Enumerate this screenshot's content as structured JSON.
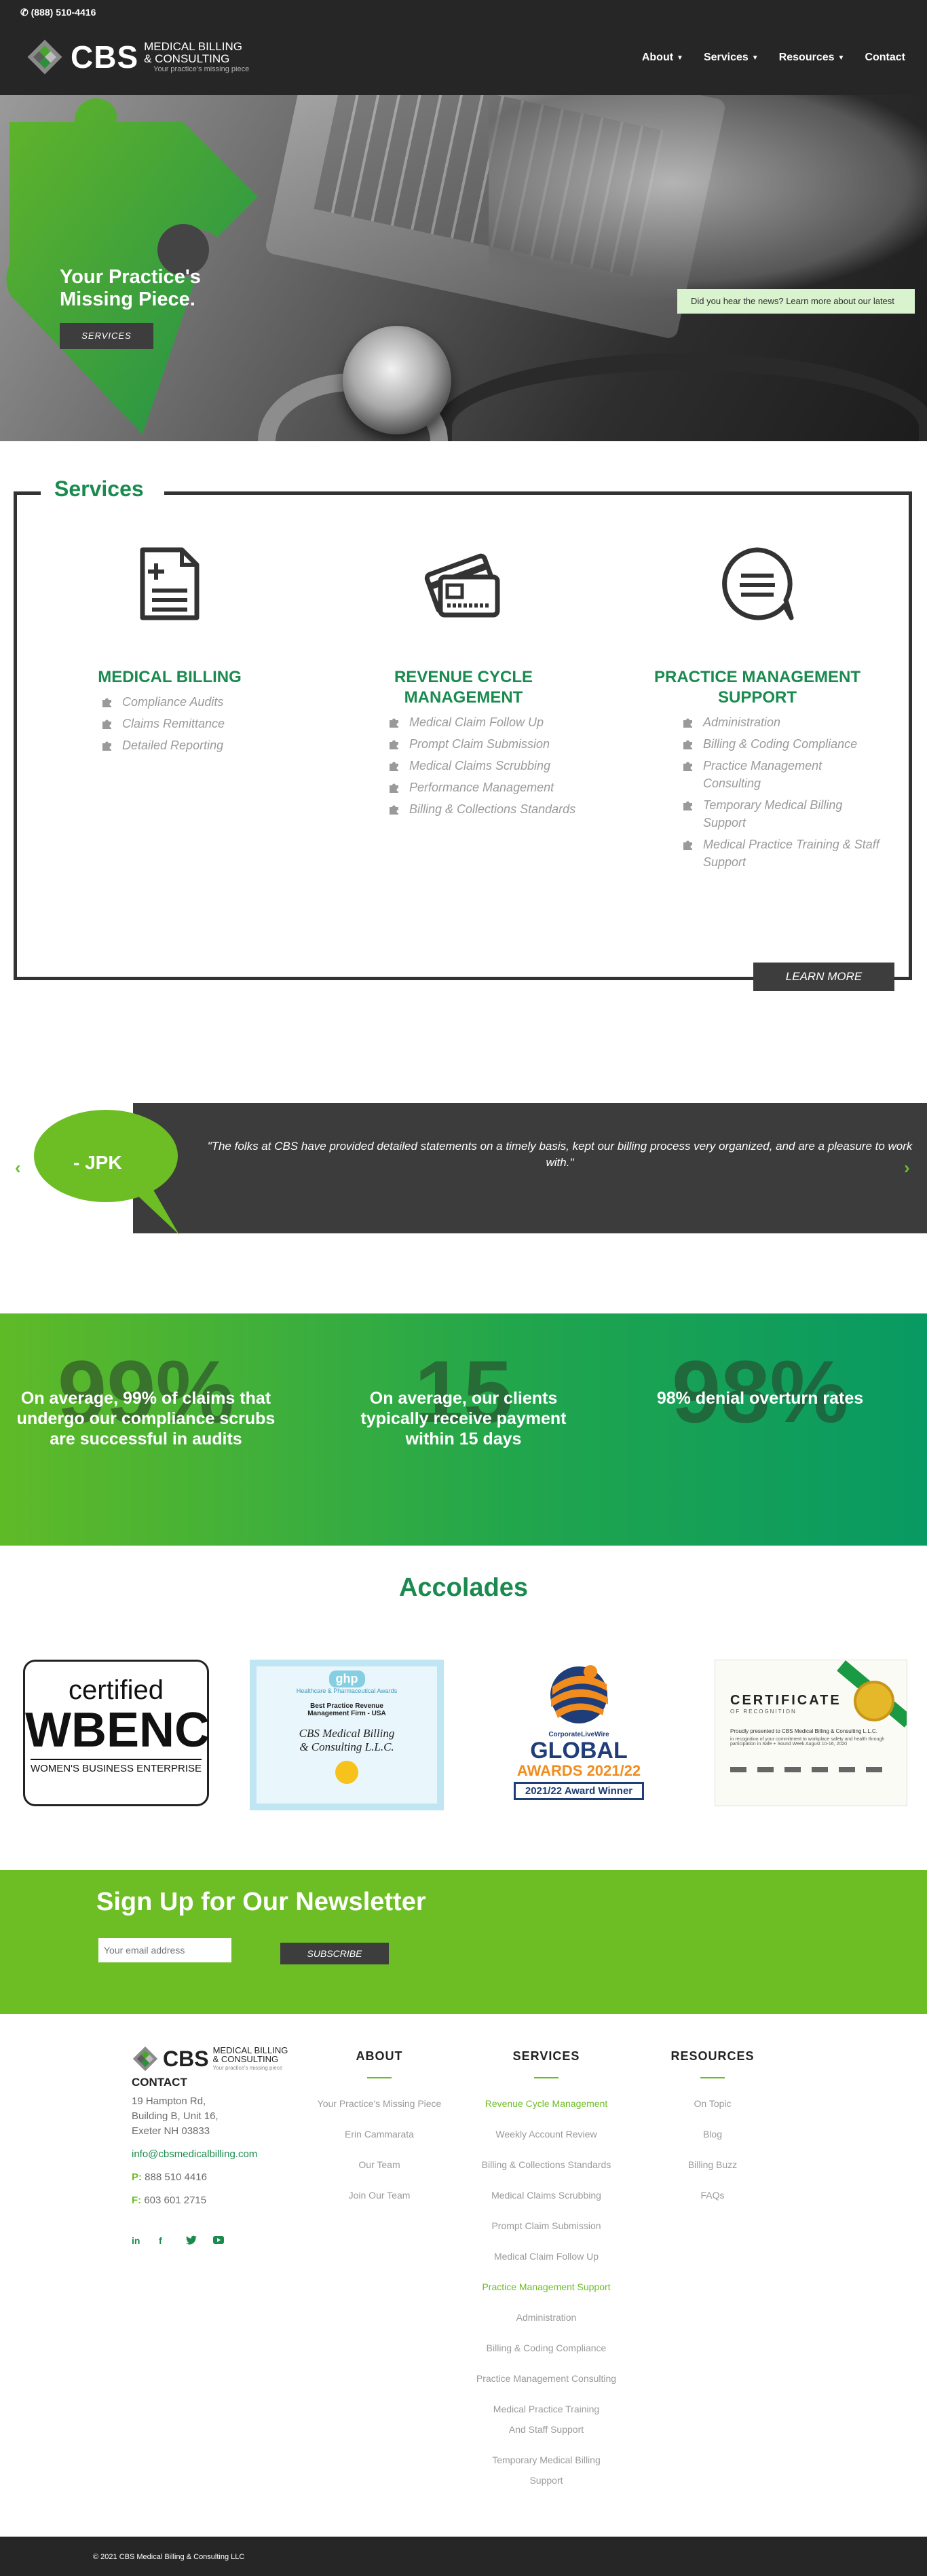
{
  "topbar": {
    "phone": "(888) 510-4416"
  },
  "header": {
    "logo_cbs": "CBS",
    "logo_line1": "MEDICAL BILLING",
    "logo_line2": "& CONSULTING",
    "logo_tagline": "Your practice's missing piece",
    "nav": [
      {
        "label": "About",
        "has_dropdown": true
      },
      {
        "label": "Services",
        "has_dropdown": true
      },
      {
        "label": "Resources",
        "has_dropdown": true
      },
      {
        "label": "Contact",
        "has_dropdown": false
      }
    ]
  },
  "hero": {
    "title_line1": "Your Practice's",
    "title_line2": "Missing Piece.",
    "button": "SERVICES",
    "note": "Did you hear the news? Learn more about our latest"
  },
  "services": {
    "heading": "Services",
    "columns": [
      {
        "icon": "document-icon",
        "title": "MEDICAL BILLING",
        "items": [
          "Compliance Audits",
          "Claims Remittance",
          "Detailed Reporting"
        ]
      },
      {
        "icon": "credit-card-icon",
        "title": "REVENUE CYCLE MANAGEMENT",
        "items": [
          "Medical Claim Follow Up",
          "Prompt Claim Submission",
          "Medical Claims Scrubbing",
          "Performance Management",
          "Billing & Collections Standards"
        ]
      },
      {
        "icon": "chat-bubble-icon",
        "title": "PRACTICE MANAGEMENT SUPPORT",
        "items": [
          "Administration",
          "Billing & Coding Compliance",
          "Practice Management Consulting",
          "Temporary Medical Billing Support",
          "Medical Practice Training & Staff Support"
        ]
      }
    ],
    "learn_more": "LEARN MORE"
  },
  "testimonial": {
    "author": "- JPK",
    "quote": "\"The folks at CBS have provided detailed statements on a timely basis, kept our billing process very organized, and are a pleasure to work with.\""
  },
  "stats": [
    {
      "big": "99%",
      "text": "On average, 99% of claims that undergo our compliance scrubs are successful in audits"
    },
    {
      "big": "15",
      "text": "On average, our clients typically receive payment within 15 days"
    },
    {
      "big": "98%",
      "text": "98% denial overturn rates"
    }
  ],
  "accolades": {
    "title": "Accolades",
    "wbenc": {
      "line1": "certified",
      "line2": "WBENC",
      "line3": "WOMEN'S BUSINESS ENTERPRISE"
    },
    "ghp": {
      "badge": "ghp",
      "badge_sub": "Healthcare & Pharmaceutical Awards",
      "line1": "Best Practice Revenue",
      "line2": "Management Firm - USA",
      "name1": "CBS Medical Billing",
      "name2": "& Consulting L.L.C."
    },
    "global": {
      "brand": "CorporateLiveWire",
      "line1": "GLOBAL",
      "line2": "AWARDS 2021/22",
      "badge": "2021/22 Award Winner"
    },
    "certificate": {
      "title": "CERTIFICATE",
      "sub": "OF RECOGNITION",
      "text1": "Proudly presented to CBS Medical Billing & Consulting L.L.C.",
      "text2": "in recognition of your commitment to workplace safety and health through",
      "text3": "participation in Safe + Sound Week August 10-16, 2020"
    }
  },
  "newsletter": {
    "title": "Sign Up for Our Newsletter",
    "placeholder": "Your email address",
    "button": "SUBSCRIBE"
  },
  "footer": {
    "contact_title": "CONTACT",
    "address1": "19 Hampton Rd,",
    "address2": "Building B, Unit 16,",
    "address3": "Exeter NH 03833",
    "email": "info@cbsmedicalbilling.com",
    "phone_label": "P:",
    "phone": "888 510 4416",
    "fax_label": "F:",
    "fax": "603 601 2715",
    "social": [
      "in",
      "f",
      "t",
      "yt"
    ],
    "columns": [
      {
        "title": "ABOUT",
        "links": [
          {
            "label": "Your Practice's Missing Piece",
            "accent": false
          },
          {
            "label": "Erin Cammarata",
            "accent": false
          },
          {
            "label": "Our Team",
            "accent": false
          },
          {
            "label": "Join Our Team",
            "accent": false
          }
        ]
      },
      {
        "title": "SERVICES",
        "links": [
          {
            "label": "Revenue Cycle Management",
            "accent": true
          },
          {
            "label": "Weekly Account Review",
            "accent": false
          },
          {
            "label": "Billing & Collections Standards",
            "accent": false
          },
          {
            "label": "Medical Claims Scrubbing",
            "accent": false
          },
          {
            "label": "Prompt Claim Submission",
            "accent": false
          },
          {
            "label": "Medical Claim Follow Up",
            "accent": false
          },
          {
            "label": "Practice Management Support",
            "accent": true
          },
          {
            "label": "Administration",
            "accent": false
          },
          {
            "label": "Billing & Coding Compliance",
            "accent": false
          },
          {
            "label": "Practice Management Consulting",
            "accent": false
          },
          {
            "label": "Medical Practice Training And Staff Support",
            "accent": false
          },
          {
            "label": "Temporary Medical Billing Support",
            "accent": false
          }
        ]
      },
      {
        "title": "RESOURCES",
        "links": [
          {
            "label": "On Topic",
            "accent": false
          },
          {
            "label": "Blog",
            "accent": false
          },
          {
            "label": "Billing Buzz",
            "accent": false
          },
          {
            "label": "FAQs",
            "accent": false
          }
        ]
      }
    ],
    "copyright": "© 2021 CBS Medical Billing & Consulting LLC"
  },
  "colors": {
    "brand_green": "#1a8a4f",
    "accent_green": "#6dbd24",
    "dark": "#262626"
  }
}
